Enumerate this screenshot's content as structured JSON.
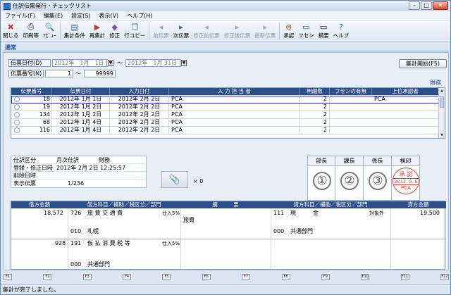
{
  "window": {
    "title": "仕訳伝票発行・チェックリスト",
    "min": "–",
    "max": "□",
    "close": "✕"
  },
  "menu": [
    "ファイル(F)",
    "編集(E)",
    "設定(S)",
    "表示(V)",
    "ヘルプ(H)"
  ],
  "toolbar": [
    {
      "label": "閉じる",
      "icon": "close-icon",
      "enabled": true
    },
    {
      "label": "印刷等",
      "icon": "printer-icon",
      "enabled": true
    },
    {
      "label": "ｱﾋﾞｭｰ",
      "icon": "preview-icon",
      "enabled": true
    },
    {
      "label": "集計条件",
      "icon": "condition-icon",
      "enabled": true
    },
    {
      "label": "再集計",
      "icon": "recalc-icon",
      "enabled": true
    },
    {
      "label": "修正",
      "icon": "edit-icon",
      "enabled": true
    },
    {
      "label": "行コピー",
      "icon": "copy-icon",
      "enabled": true
    },
    {
      "label": "前伝票",
      "icon": "prev-icon",
      "enabled": false
    },
    {
      "label": "次伝票",
      "icon": "next-icon",
      "enabled": true
    },
    {
      "label": "修正前伝票",
      "icon": "before-edit-icon",
      "enabled": false
    },
    {
      "label": "修正後伝票",
      "icon": "after-edit-icon",
      "enabled": false
    },
    {
      "label": "最新伝票",
      "icon": "latest-icon",
      "enabled": false
    },
    {
      "label": "承認",
      "icon": "approve-icon",
      "enabled": true
    },
    {
      "label": "フセン",
      "icon": "sticky-icon",
      "enabled": true
    },
    {
      "label": "摘要",
      "icon": "summary-icon",
      "enabled": true
    },
    {
      "label": "ヘルプ",
      "icon": "help-icon",
      "enabled": true
    }
  ],
  "tab": "通常",
  "filter": {
    "date_label": "伝票日付(D)",
    "date_from": "2012年　1月　1日",
    "date_to": "2012年　1月 31日",
    "tilde": "～",
    "number_label": "伝票番号(N)",
    "number_from": "1",
    "number_to": "99999",
    "run_button": "集計開始(F5)",
    "dept_label": "財務"
  },
  "grid": {
    "headers": [
      "伝票番号",
      "伝票日付",
      "入力日付",
      "入 力 担 当 者",
      "明細数",
      "フセンの有無",
      "上位承認者"
    ],
    "rows": [
      {
        "no": "18",
        "date": "2012年 1月 1日",
        "input": "2012年 2月 2日",
        "user": "PCA",
        "count": "2",
        "sticky": "",
        "approver": "PCA"
      },
      {
        "no": "19",
        "date": "2012年 1月 2日",
        "input": "2012年 2月 2日",
        "user": "PCA",
        "count": "2",
        "sticky": "",
        "approver": ""
      },
      {
        "no": "134",
        "date": "2012年 1月 2日",
        "input": "2012年 2月 2日",
        "user": "PCA",
        "count": "2",
        "sticky": "",
        "approver": ""
      },
      {
        "no": "68",
        "date": "2012年 1月 4日",
        "input": "2012年 2月 2日",
        "user": "PCA",
        "count": "2",
        "sticky": "",
        "approver": ""
      },
      {
        "no": "116",
        "date": "2012年 1月 4日",
        "input": "2012年 2月 2日",
        "user": "PCA",
        "count": "2",
        "sticky": "",
        "approver": ""
      }
    ]
  },
  "info": {
    "type_label": "仕訳区分",
    "type_value": "月次仕訳",
    "type_dept": "財務",
    "reg_label": "登録・修正日時",
    "reg_value": "2012年 2月 2日 12:25:57",
    "del_label": "削除日時",
    "del_value": "",
    "disp_label": "表示伝票",
    "disp_value": "1/236"
  },
  "attach": {
    "count": "× 0"
  },
  "approval": [
    {
      "title": "部長",
      "mark": "①"
    },
    {
      "title": "課長",
      "mark": "②"
    },
    {
      "title": "係長",
      "mark": "③"
    },
    {
      "title": "検印",
      "seal": {
        "top": "承 認",
        "mid": "2012. 9. 5",
        "bot": "PCA"
      }
    }
  ],
  "journal": {
    "headers": [
      "借方金額",
      "借方科目／補助／税区分／部門",
      "摘　　　要",
      "貸方科目／補助／税区分／部門",
      "貸方金額"
    ],
    "debit1": {
      "amount": "18,572",
      "code": "726",
      "name": "旅 費 交 通 費",
      "tax": "仕入5%",
      "sub_code": "010",
      "sub_name": "札幌"
    },
    "debit2": {
      "amount": "928",
      "code": "191",
      "name": "仮 払 消 費 税 等",
      "tax": "仕入5%",
      "dept_code": "000",
      "dept_name": "共通部門"
    },
    "memo": "旅費",
    "credit1": {
      "code": "111",
      "name": "現　　　金",
      "tax": "対象外",
      "amount": "19,500",
      "dept_code": "000",
      "dept_name": "共通部門"
    }
  },
  "fkeys": [
    "F1",
    "F2",
    "F3",
    "F4",
    "F5",
    "F6",
    "F7",
    "F8",
    "F9",
    "F10",
    "F11",
    "F12"
  ],
  "status": "集計が完了しました。"
}
